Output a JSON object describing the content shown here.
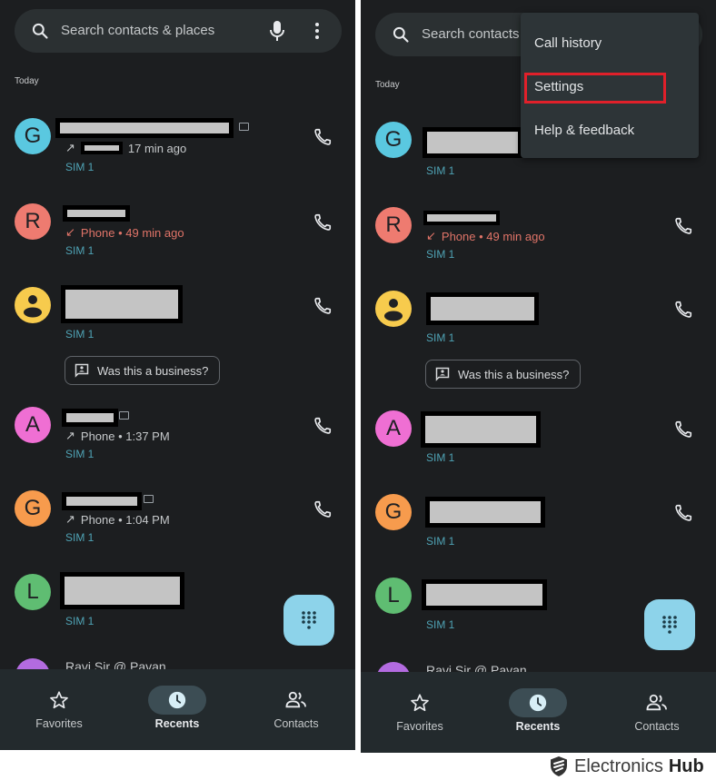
{
  "search": {
    "placeholder_full": "Search contacts & places",
    "placeholder_truncated": "Search contacts"
  },
  "section_label": "Today",
  "entries": [
    {
      "initial": "G",
      "avatar_color": "#5ac8e0",
      "call_type": "outgoing",
      "detail": "17 min ago",
      "sim": "SIM 1",
      "hd": true
    },
    {
      "initial": "R",
      "avatar_color": "#ee7b70",
      "call_type": "missed",
      "detail": "Phone • 49 min ago",
      "sim": "SIM 1",
      "hd": false
    },
    {
      "initial": "",
      "avatar_color": "#f7cb4d",
      "call_type": "unknown-person",
      "detail": "",
      "sim": "SIM 1",
      "hd": false,
      "chip": "Was this a business?"
    },
    {
      "initial": "A",
      "avatar_color": "#ef6fd3",
      "call_type": "outgoing",
      "detail": "Phone • 1:37 PM",
      "sim": "SIM 1",
      "hd": true
    },
    {
      "initial": "G",
      "avatar_color": "#f79b4d",
      "call_type": "outgoing",
      "detail": "Phone • 1:04 PM",
      "sim": "SIM 1",
      "hd": true
    },
    {
      "initial": "L",
      "avatar_color": "#5fbd72",
      "call_type": "",
      "detail": "",
      "sim": "SIM 1",
      "hd": false
    }
  ],
  "partial_entry": {
    "text": "Ravi Sir @ Pavan",
    "avatar_color": "#b36be0"
  },
  "nav": [
    {
      "label": "Favorites",
      "icon": "star-icon",
      "active": false
    },
    {
      "label": "Recents",
      "icon": "clock-icon",
      "active": true
    },
    {
      "label": "Contacts",
      "icon": "people-icon",
      "active": false
    }
  ],
  "menu": {
    "items": [
      "Call history",
      "Settings",
      "Help & feedback"
    ],
    "highlighted": "Settings",
    "highlight_color": "#e0202a"
  },
  "watermark": {
    "brand_regular": "Electronics",
    "brand_bold": "Hub"
  },
  "colors": {
    "background": "#1c1e20",
    "sim_text": "#4fa3b5",
    "missed_text": "#e07468",
    "fab": "#8dd3ea",
    "navbar": "#232a2d"
  }
}
